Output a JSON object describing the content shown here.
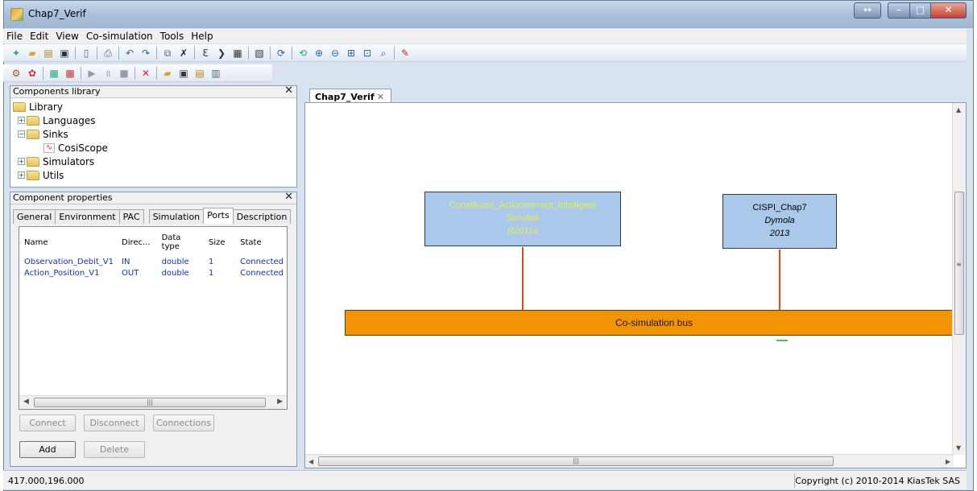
{
  "window": {
    "title": "Chap7_Verif"
  },
  "menu": [
    "File",
    "Edit",
    "View",
    "Co-simulation",
    "Tools",
    "Help"
  ],
  "library": {
    "header": "Components library",
    "root": "Library",
    "items": [
      "Languages",
      "Sinks",
      "CosiScope",
      "Simulators",
      "Utils"
    ]
  },
  "properties": {
    "header": "Component properties",
    "tabs": [
      "General",
      "Environment",
      "PAC",
      "Simulation",
      "Ports",
      "Description"
    ],
    "active_tab": "Ports",
    "columns": [
      "Name",
      "Direc...",
      "Data type",
      "Size",
      "State"
    ],
    "rows": [
      [
        "Observation_Debit_V1",
        "IN",
        "double",
        "1",
        "Connected"
      ],
      [
        "Action_Position_V1",
        "OUT",
        "double",
        "1",
        "Connected"
      ]
    ],
    "buttons": {
      "connect": "Connect",
      "disconnect": "Disconnect",
      "connections": "Connections",
      "add": "Add",
      "delete": "Delete"
    }
  },
  "document": {
    "tab": "Chap7_Verif",
    "blocks": [
      {
        "name": "Constituant_Actionnement_Intelligent",
        "tool": "Simulink",
        "version": "R2011a"
      },
      {
        "name": "CISPI_Chap7",
        "tool": "Dymola",
        "version": "2013"
      }
    ],
    "bus_label": "Co-simulation bus"
  },
  "status": {
    "coords": "417.000,196.000",
    "copyright": "Copyright (c) 2010-2014 KiasTek SAS"
  },
  "colors": {
    "block": "#a9c8ea",
    "bus": "#f29400",
    "wire": "#d64b1a"
  }
}
